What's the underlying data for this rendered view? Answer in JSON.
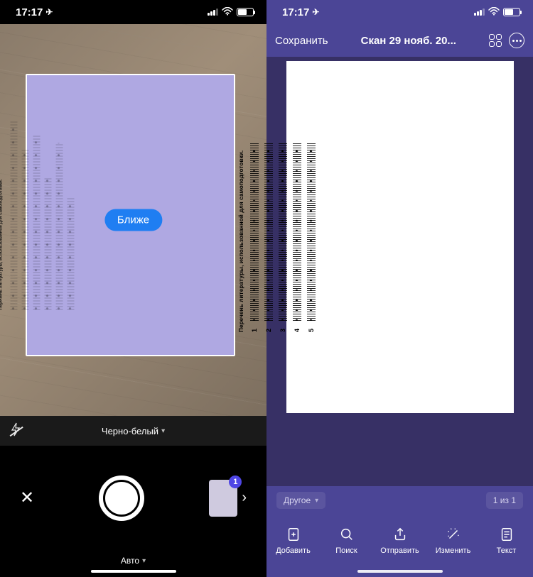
{
  "status": {
    "time": "17:17",
    "send_arrow": "➤"
  },
  "left": {
    "hint": "Ближе",
    "filter_name": "Черно-белый",
    "mode": "Авто",
    "badge_count": "1"
  },
  "right": {
    "save": "Сохранить",
    "title": "Скан 29 нояб. 20...",
    "tag_label": "Другое",
    "page_indicator": "1 из 1",
    "tools": {
      "add": "Добавить",
      "search": "Поиск",
      "send": "Отправить",
      "edit": "Изменить",
      "text": "Текст"
    }
  },
  "document": {
    "heading": "Перечень литературы, использованной для самоподготовки.",
    "items": [
      "1",
      "2",
      "3",
      "4",
      "5"
    ]
  }
}
